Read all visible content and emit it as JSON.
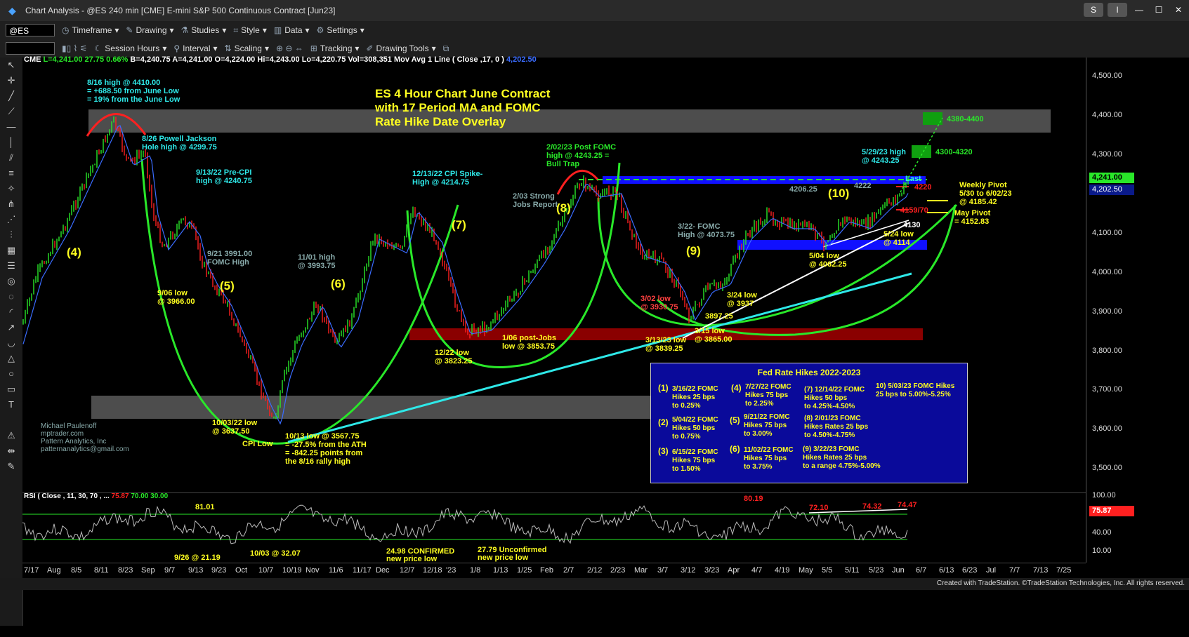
{
  "window": {
    "title": "Chart Analysis - @ES 240 min [CME] E-mini S&P 500 Continuous Contract [Jun23]",
    "btn_s": "S",
    "btn_i": "I"
  },
  "toolbar1": {
    "symbol": "@ES",
    "items": [
      "Timeframe",
      "Drawing",
      "Studies",
      "Style",
      "Data",
      "Settings"
    ]
  },
  "toolbar2": {
    "items": [
      "Session Hours",
      "Interval",
      "Scaling",
      "Tracking",
      "Drawing Tools"
    ]
  },
  "header": {
    "exchange": "CME",
    "L": "L=4,241.00",
    "chg": "27.75",
    "pct": "0.66%",
    "B": "B=4,240.75",
    "A": "A=4,241.00",
    "O": "O=4,224.00",
    "Hi": "Hi=4,243.00",
    "Lo": "Lo=4,220.75",
    "Vol": "Vol=308,351",
    "ma": "Mov Avg 1 Line ( Close ,17, 0 )",
    "ma_val": "4,202.50"
  },
  "chart_title": {
    "line1": "ES 4 Hour Chart June Contract",
    "line2": "with 17 Period MA and FOMC",
    "line3": "Rate Hike Date Overlay"
  },
  "annotations": {
    "a816_1": "8/16 high @ 4410.00",
    "a816_2": "= +688.50 from June Low",
    "a816_3": "= 19% from the June Low",
    "a826_1": "8/26 Powell Jackson",
    "a826_2": "Hole high @ 4299.75",
    "a913_1": "9/13/22 Pre-CPI",
    "a913_2": "high @ 4240.75",
    "a921_1": "9/21 3991.00",
    "a921_2": "FOMC High",
    "a906_1": "9/06 low",
    "a906_2": "@ 3966.00",
    "a1101_1": "11/01 high",
    "a1101_2": "@ 3993.75",
    "a1003_1": "10/03/22 low",
    "a1003_2": "@ 3637.50",
    "cpi_low": "CPI Low",
    "a1013_1": "10/13 low @ 3567.75",
    "a1013_2": "= -27.5% from the ATH",
    "a1013_3": "= -842.25 points from",
    "a1013_4": "the 8/16 rally high",
    "a1213_1": "12/13/22 CPI Spike-",
    "a1213_2": "High @ 4214.75",
    "a1222_1": "12/22 low",
    "a1222_2": "@ 3823.25",
    "a106_1": "1/06 post-Jobs",
    "a106_2": "low @ 3853.75",
    "a202_1": "2/02/23 Post FOMC",
    "a202_2": "high @ 4243.25 =",
    "a202_3": "Bull Trap",
    "a203_1": "2/03 Strong",
    "a203_2": "Jobs Report",
    "a322_1": "3/22- FOMC",
    "a322_2": "High @ 4073.75",
    "a302_1": "3/02 low",
    "a302_2": "@ 3930.75",
    "a3897": "3897.25",
    "a313_1": "3/13/23 low",
    "a313_2": "@ 3839.25",
    "a315_1": "3/15 low",
    "a315_2": "@ 3865.00",
    "a324_1": "3/24 low",
    "a324_2": "@ 3937",
    "a4206": "4206.25",
    "a4222": "4222",
    "a504_1": "5/04 low",
    "a504_2": "@ 4062.25",
    "a529_1": "5/29/23 high",
    "a529_2": "@ 4243.25",
    "a524_1": "5/24 low",
    "a524_2": "@ 4114",
    "a4130": "4130",
    "a4380": "4380-4400",
    "a4300": "4300-4320",
    "last": "Last",
    "p4220": "4220",
    "p4159": "4159/70",
    "wp1": "Weekly Pivot",
    "wp2": "5/30 to 6/02/23",
    "wp3": "@ 4185.42",
    "mp1": "May Pivot",
    "mp2": "= 4152.83",
    "author1": "Michael Paulenoff",
    "author2": "mptrader.com",
    "author3": "Pattern Analytics, Inc",
    "author4": "patternanalytics@gmail.com",
    "w4": "(4)",
    "w5": "(5)",
    "w6": "(6)",
    "w7": "(7)",
    "w8": "(8)",
    "w9": "(9)",
    "w10": "(10)"
  },
  "fed_box": {
    "title": "Fed Rate Hikes 2022-2023",
    "n1": "(1)",
    "e1": "3/16/22 FOMC\nHikes 25 bps\nto 0.25%",
    "n2": "(2)",
    "e2": "5/04/22 FOMC\nHikes 50 bps\nto 0.75%",
    "n3": "(3)",
    "e3": "6/15/22 FOMC\nHikes 75 bps\nto 1.50%",
    "n4": "(4)",
    "e4": "7/27/22 FOMC\nHikes 75 bps\nto 2.25%",
    "n5": "(5)",
    "e5": "9/21/22 FOMC\nHikes 75 bps\nto 3.00%",
    "n6": "(6)",
    "e6": "11/02/22 FOMC\nHikes 75 bps\nto 3.75%",
    "e7": "(7) 12/14/22 FOMC\nHikes 50 bps\nto 4.25%-4.50%",
    "e8": "(8) 2/01/23 FOMC\nHikes Rates 25 bps\nto 4.50%-4.75%",
    "e9": "(9) 3/22/23 FOMC\nHikes Rates 25 bps\nto a range 4.75%-5.00%",
    "e10": "10) 5/03/23 FOMC Hikes\n25 bps to 5.00%-5.25%"
  },
  "price_axis": {
    "ticks": [
      "4,500.00",
      "4,400.00",
      "4,300.00",
      "4,200.00",
      "4,100.00",
      "4,000.00",
      "3,900.00",
      "3,800.00",
      "3,700.00",
      "3,600.00",
      "3,500.00"
    ],
    "last_label": "4,241.00",
    "ma_label": "4,202.50"
  },
  "rsi": {
    "header": "RSI ( Close , 11, 30, 70 , ...",
    "val1": "75.87",
    "val2": "70.00",
    "val3": "30.00",
    "ticks": [
      "100.00",
      "70.00",
      "40.00",
      "10.00"
    ],
    "last_label": "75.87",
    "r8101": "81.01",
    "r926": "9/26 @ 21.19",
    "r1003": "10/03 @ 32.07",
    "r2498_1": "24.98 CONFIRMED",
    "r2498_2": "new price low",
    "r2779_1": "27.79 Unconfirmed",
    "r2779_2": "new price low",
    "r8019": "80.19",
    "r7210": "72.10",
    "r7432": "74.32",
    "r7447": "74.47"
  },
  "dates": [
    "7/17",
    "Aug",
    "8/5",
    "8/11",
    "8/23",
    "Sep",
    "9/7",
    "9/13",
    "9/23",
    "Oct",
    "10/7",
    "10/19",
    "Nov",
    "11/6",
    "11/17",
    "Dec",
    "12/7",
    "12/18",
    "'23",
    "1/8",
    "1/13",
    "1/25",
    "Feb",
    "2/7",
    "2/12",
    "2/23",
    "Mar",
    "3/7",
    "3/12",
    "3/23",
    "Apr",
    "4/7",
    "4/19",
    "May",
    "5/5",
    "5/11",
    "5/23",
    "Jun",
    "6/7",
    "6/13",
    "6/23",
    "Jul",
    "7/7",
    "7/13",
    "7/25"
  ],
  "footer": "Created with TradeStation. ©TradeStation Technologies, Inc. All rights reserved.",
  "colors": {
    "bull": "#29e829",
    "bear": "#ff2020",
    "ma": "#3a6cff",
    "annot_cyan": "#2ee8e8",
    "annot_yellow": "#ffff20"
  }
}
